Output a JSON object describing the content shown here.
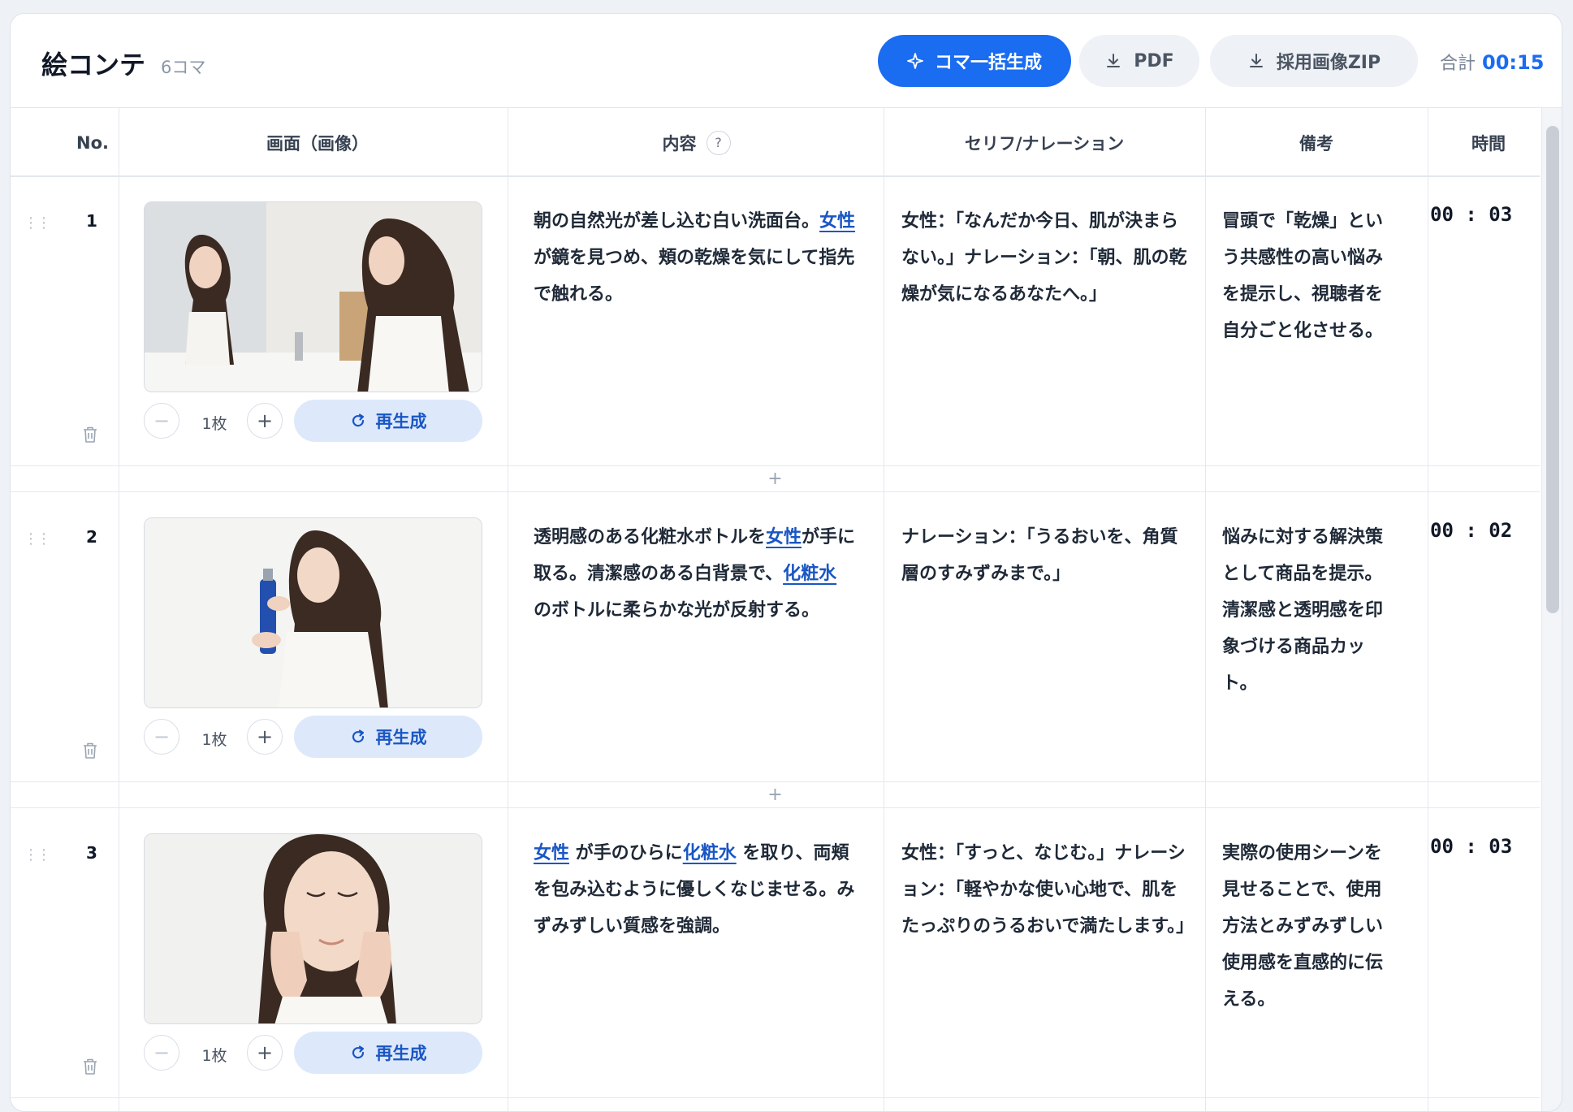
{
  "header": {
    "title": "絵コンテ",
    "frame_count": "6コマ",
    "generate_label": "コマ一括生成",
    "pdf_label": "PDF",
    "zip_label": "採用画像ZIP",
    "total_label": "合計",
    "total_value": "00:15"
  },
  "table": {
    "headers": {
      "no": "No.",
      "image": "画面（画像）",
      "content": "内容",
      "content_help": "?",
      "line": "セリフ/ナレーション",
      "note": "備考",
      "time": "時間"
    }
  },
  "rows": [
    {
      "no": "1",
      "qty": "1枚",
      "regen": "再生成",
      "content_parts": [
        {
          "text": "朝の自然光が差し込む白い洗面台。",
          "link": false
        },
        {
          "text": "女性",
          "link": true
        },
        {
          "text": " が鏡を見つめ、頬の乾燥を気にして指先で触れる。",
          "link": false
        }
      ],
      "line": "女性：「なんだか今日、肌が決まらない。」ナレーション：「朝、肌の乾燥が気になるあなたへ。」",
      "note": "冒頭で「乾燥」という共感性の高い悩みを提示し、視聴者を自分ごと化させる。",
      "time": "00 : 03"
    },
    {
      "no": "2",
      "qty": "1枚",
      "regen": "再生成",
      "content_parts": [
        {
          "text": "透明感のある化粧水ボトルを",
          "link": false
        },
        {
          "text": "女性",
          "link": true
        },
        {
          "text": "が手に取る。清潔感のある白背景で、",
          "link": false
        },
        {
          "text": "化粧水",
          "link": true
        },
        {
          "text": " のボトルに柔らかな光が反射する。",
          "link": false
        }
      ],
      "line": "ナレーション：「うるおいを、角質層のすみずみまで。」",
      "note": "悩みに対する解決策として商品を提示。清潔感と透明感を印象づける商品カット。",
      "time": "00 : 02"
    },
    {
      "no": "3",
      "qty": "1枚",
      "regen": "再生成",
      "content_parts": [
        {
          "text": "女性",
          "link": true
        },
        {
          "text": " が手のひらに",
          "link": false
        },
        {
          "text": "化粧水",
          "link": true
        },
        {
          "text": " を取り、両頬を包み込むように優しくなじませる。みずみずしい質感を強調。",
          "link": false
        }
      ],
      "line": "女性：「すっと、なじむ。」ナレーション：「軽やかな使い心地で、肌をたっぷりのうるおいで満たします。」",
      "note": "実際の使用シーンを見せることで、使用方法とみずみずしい使用感を直感的に伝える。",
      "time": "00 : 03"
    }
  ],
  "add_row_label": "+",
  "colors": {
    "accent": "#1a6cf0",
    "link": "#1a56c4",
    "regen_bg": "#dde9fb"
  }
}
